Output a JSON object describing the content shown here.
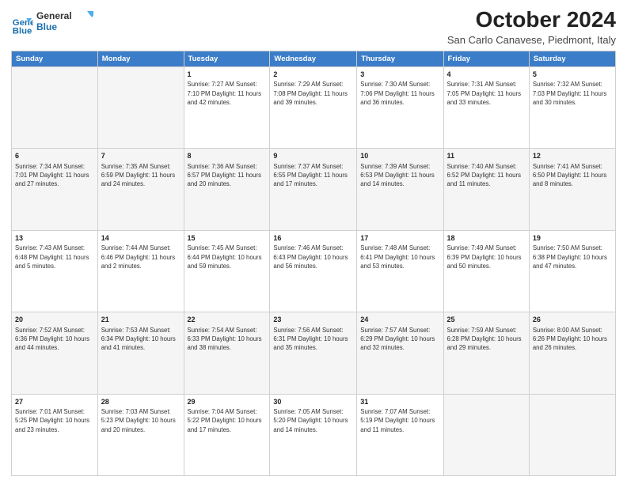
{
  "header": {
    "logo_line1": "General",
    "logo_line2": "Blue",
    "month": "October 2024",
    "location": "San Carlo Canavese, Piedmont, Italy"
  },
  "days_of_week": [
    "Sunday",
    "Monday",
    "Tuesday",
    "Wednesday",
    "Thursday",
    "Friday",
    "Saturday"
  ],
  "weeks": [
    [
      {
        "num": "",
        "info": ""
      },
      {
        "num": "",
        "info": ""
      },
      {
        "num": "1",
        "info": "Sunrise: 7:27 AM\nSunset: 7:10 PM\nDaylight: 11 hours\nand 42 minutes."
      },
      {
        "num": "2",
        "info": "Sunrise: 7:29 AM\nSunset: 7:08 PM\nDaylight: 11 hours\nand 39 minutes."
      },
      {
        "num": "3",
        "info": "Sunrise: 7:30 AM\nSunset: 7:06 PM\nDaylight: 11 hours\nand 36 minutes."
      },
      {
        "num": "4",
        "info": "Sunrise: 7:31 AM\nSunset: 7:05 PM\nDaylight: 11 hours\nand 33 minutes."
      },
      {
        "num": "5",
        "info": "Sunrise: 7:32 AM\nSunset: 7:03 PM\nDaylight: 11 hours\nand 30 minutes."
      }
    ],
    [
      {
        "num": "6",
        "info": "Sunrise: 7:34 AM\nSunset: 7:01 PM\nDaylight: 11 hours\nand 27 minutes."
      },
      {
        "num": "7",
        "info": "Sunrise: 7:35 AM\nSunset: 6:59 PM\nDaylight: 11 hours\nand 24 minutes."
      },
      {
        "num": "8",
        "info": "Sunrise: 7:36 AM\nSunset: 6:57 PM\nDaylight: 11 hours\nand 20 minutes."
      },
      {
        "num": "9",
        "info": "Sunrise: 7:37 AM\nSunset: 6:55 PM\nDaylight: 11 hours\nand 17 minutes."
      },
      {
        "num": "10",
        "info": "Sunrise: 7:39 AM\nSunset: 6:53 PM\nDaylight: 11 hours\nand 14 minutes."
      },
      {
        "num": "11",
        "info": "Sunrise: 7:40 AM\nSunset: 6:52 PM\nDaylight: 11 hours\nand 11 minutes."
      },
      {
        "num": "12",
        "info": "Sunrise: 7:41 AM\nSunset: 6:50 PM\nDaylight: 11 hours\nand 8 minutes."
      }
    ],
    [
      {
        "num": "13",
        "info": "Sunrise: 7:43 AM\nSunset: 6:48 PM\nDaylight: 11 hours\nand 5 minutes."
      },
      {
        "num": "14",
        "info": "Sunrise: 7:44 AM\nSunset: 6:46 PM\nDaylight: 11 hours\nand 2 minutes."
      },
      {
        "num": "15",
        "info": "Sunrise: 7:45 AM\nSunset: 6:44 PM\nDaylight: 10 hours\nand 59 minutes."
      },
      {
        "num": "16",
        "info": "Sunrise: 7:46 AM\nSunset: 6:43 PM\nDaylight: 10 hours\nand 56 minutes."
      },
      {
        "num": "17",
        "info": "Sunrise: 7:48 AM\nSunset: 6:41 PM\nDaylight: 10 hours\nand 53 minutes."
      },
      {
        "num": "18",
        "info": "Sunrise: 7:49 AM\nSunset: 6:39 PM\nDaylight: 10 hours\nand 50 minutes."
      },
      {
        "num": "19",
        "info": "Sunrise: 7:50 AM\nSunset: 6:38 PM\nDaylight: 10 hours\nand 47 minutes."
      }
    ],
    [
      {
        "num": "20",
        "info": "Sunrise: 7:52 AM\nSunset: 6:36 PM\nDaylight: 10 hours\nand 44 minutes."
      },
      {
        "num": "21",
        "info": "Sunrise: 7:53 AM\nSunset: 6:34 PM\nDaylight: 10 hours\nand 41 minutes."
      },
      {
        "num": "22",
        "info": "Sunrise: 7:54 AM\nSunset: 6:33 PM\nDaylight: 10 hours\nand 38 minutes."
      },
      {
        "num": "23",
        "info": "Sunrise: 7:56 AM\nSunset: 6:31 PM\nDaylight: 10 hours\nand 35 minutes."
      },
      {
        "num": "24",
        "info": "Sunrise: 7:57 AM\nSunset: 6:29 PM\nDaylight: 10 hours\nand 32 minutes."
      },
      {
        "num": "25",
        "info": "Sunrise: 7:59 AM\nSunset: 6:28 PM\nDaylight: 10 hours\nand 29 minutes."
      },
      {
        "num": "26",
        "info": "Sunrise: 8:00 AM\nSunset: 6:26 PM\nDaylight: 10 hours\nand 26 minutes."
      }
    ],
    [
      {
        "num": "27",
        "info": "Sunrise: 7:01 AM\nSunset: 5:25 PM\nDaylight: 10 hours\nand 23 minutes."
      },
      {
        "num": "28",
        "info": "Sunrise: 7:03 AM\nSunset: 5:23 PM\nDaylight: 10 hours\nand 20 minutes."
      },
      {
        "num": "29",
        "info": "Sunrise: 7:04 AM\nSunset: 5:22 PM\nDaylight: 10 hours\nand 17 minutes."
      },
      {
        "num": "30",
        "info": "Sunrise: 7:05 AM\nSunset: 5:20 PM\nDaylight: 10 hours\nand 14 minutes."
      },
      {
        "num": "31",
        "info": "Sunrise: 7:07 AM\nSunset: 5:19 PM\nDaylight: 10 hours\nand 11 minutes."
      },
      {
        "num": "",
        "info": ""
      },
      {
        "num": "",
        "info": ""
      }
    ]
  ]
}
